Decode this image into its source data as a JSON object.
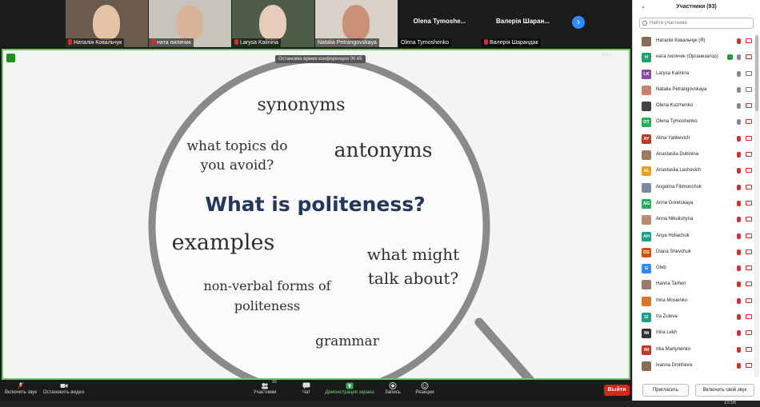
{
  "video_strip": [
    {
      "name": "Наталія Ковальчук",
      "muted": true,
      "bg": "#6b5a4e",
      "face": "#e5c3a6"
    },
    {
      "name": "ната пилячик",
      "muted": true,
      "bg": "#c7c3bd",
      "face": "#d8b39a"
    },
    {
      "name": "Larysa Kalinina",
      "muted": true,
      "bg": "#4f5d48",
      "face": "#e6cdbb"
    },
    {
      "name": "Natalia Petrangovskaya",
      "muted": false,
      "bg": "#d9d0c8",
      "face": "#c98f77"
    },
    {
      "name": "Olena Tymoshenko",
      "big": "Olena Tymoshe...",
      "muted": false
    },
    {
      "name": "Валерія Шарандак",
      "big": "Валерія Шаран...",
      "muted": true
    }
  ],
  "share_badge": "Остановка время конференции 00:45",
  "view_label": "Вид",
  "slide": {
    "title": "What is politeness?",
    "words": {
      "synonyms": "synonyms",
      "antonyms": "antonyms",
      "topics_1": "what topics do",
      "topics_2": "you avoid?",
      "examples": "examples",
      "might_1": "what might",
      "might_2": "talk about?",
      "nonverbal_1": "non-verbal forms of",
      "nonverbal_2": "politeness",
      "grammar": "grammar"
    },
    "title_color": "#25375a"
  },
  "toolbar": {
    "audio": "Включить звук",
    "video": "Остановить видео",
    "participants": "Участники",
    "participants_count": "93",
    "chat": "Чат",
    "share": "Демонстрация экрана",
    "record": "Запись",
    "reactions": "Реакции",
    "leave": "Выйти"
  },
  "taskbar_time": "10:56",
  "panel": {
    "title": "Участники (93)",
    "search_placeholder": "Найти участника",
    "invite": "Пригласить",
    "unmute": "Включить свой звук",
    "participants": [
      {
        "name": "Наталія Ковальчук (Я)",
        "initials": "",
        "color": "#8a6b55",
        "mic": "red",
        "cam": "red"
      },
      {
        "name": "ната пилячик (Организатор)",
        "initials": "H",
        "color": "#1f9f6a",
        "mic": "green",
        "cam": "red"
      },
      {
        "name": "Larysa Kalinina",
        "initials": "LK",
        "color": "#8e44ad",
        "mic": "gray",
        "cam": "gray"
      },
      {
        "name": "Natalia Petrangovskaya",
        "initials": "",
        "color": "#c9826a",
        "mic": "gray",
        "cam": "gray"
      },
      {
        "name": "Olena Kuzmenko",
        "initials": "",
        "color": "#444444",
        "mic": "gray",
        "cam": "red"
      },
      {
        "name": "Olena Tymoshenko",
        "initials": "OT",
        "color": "#27ae60",
        "mic": "gray",
        "cam": "red"
      },
      {
        "name": "Alina Yankevich",
        "initials": "AY",
        "color": "#c0392b",
        "mic": "red",
        "cam": "red"
      },
      {
        "name": "Anastasiia Dubinina",
        "initials": "",
        "color": "#a07a60",
        "mic": "red",
        "cam": "red"
      },
      {
        "name": "Anastasiia Lashevich",
        "initials": "AL",
        "color": "#e6a117",
        "mic": "red",
        "cam": "red"
      },
      {
        "name": "Angelina Filimonchuk",
        "initials": "",
        "color": "#7a8aa0",
        "mic": "red",
        "cam": "red"
      },
      {
        "name": "Anna Goretskaya",
        "initials": "AG",
        "color": "#27ae60",
        "mic": "red",
        "cam": "red"
      },
      {
        "name": "Anna Nikulishyna",
        "initials": "",
        "color": "#b98a70",
        "mic": "red",
        "cam": "red"
      },
      {
        "name": "Anya Holiachuk",
        "initials": "AH",
        "color": "#16a085",
        "mic": "red",
        "cam": "red"
      },
      {
        "name": "Diana Shevchuk",
        "initials": "DS",
        "color": "#d35400",
        "mic": "red",
        "cam": "red"
      },
      {
        "name": "Gleb",
        "initials": "G",
        "color": "#2d8cff",
        "mic": "red",
        "cam": "red"
      },
      {
        "name": "Hanna Tarhon",
        "initials": "",
        "color": "#9a7b6a",
        "mic": "red",
        "cam": "red"
      },
      {
        "name": "Inna Mosienko",
        "initials": "",
        "color": "#d9752a",
        "mic": "red",
        "cam": "red"
      },
      {
        "name": "Ira Zuieva",
        "initials": "IZ",
        "color": "#16a085",
        "mic": "red",
        "cam": "red"
      },
      {
        "name": "Irina Lekh",
        "initials": "IM",
        "color": "#333333",
        "mic": "red",
        "cam": "red"
      },
      {
        "name": "Irka Martynenko",
        "initials": "IM",
        "color": "#c0392b",
        "mic": "red",
        "cam": "red"
      },
      {
        "name": "Ivanna Dmitrieva",
        "initials": "",
        "color": "#8a6b55",
        "mic": "red",
        "cam": "red"
      }
    ]
  },
  "colors": {
    "accent": "#2d8cff",
    "leave": "#d9251c",
    "share_border": "#6fc36f",
    "muted": "#e02828"
  }
}
